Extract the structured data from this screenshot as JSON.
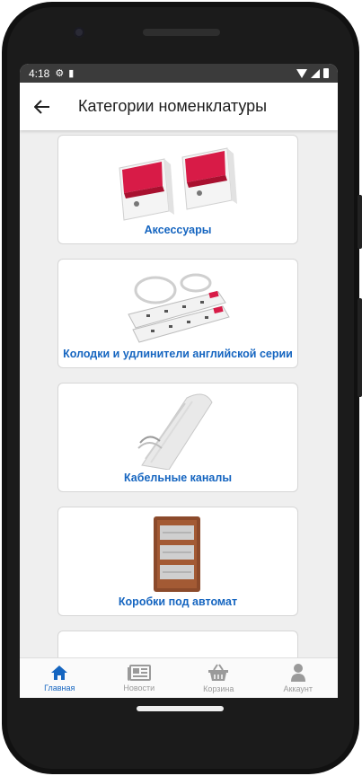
{
  "status": {
    "time": "4:18"
  },
  "appbar": {
    "title": "Категории номенклатуры"
  },
  "categories": [
    {
      "label": "Аксессуары",
      "image": "rocker-switch"
    },
    {
      "label": "Колодки и удлинители английской серии",
      "image": "extension-cord"
    },
    {
      "label": "Кабельные каналы",
      "image": "cable-channel"
    },
    {
      "label": "Коробки под автомат",
      "image": "breaker-box"
    },
    {
      "label": "",
      "image": "partial-item"
    }
  ],
  "tabs": [
    {
      "label": "Главная",
      "icon": "home-icon",
      "active": true
    },
    {
      "label": "Новости",
      "icon": "newspaper-icon",
      "active": false
    },
    {
      "label": "Корзина",
      "icon": "basket-icon",
      "active": false
    },
    {
      "label": "Аккаунт",
      "icon": "person-icon",
      "active": false
    }
  ],
  "colors": {
    "accent": "#1565c0",
    "statusbar": "#3b3b3b",
    "background": "#efefef"
  }
}
